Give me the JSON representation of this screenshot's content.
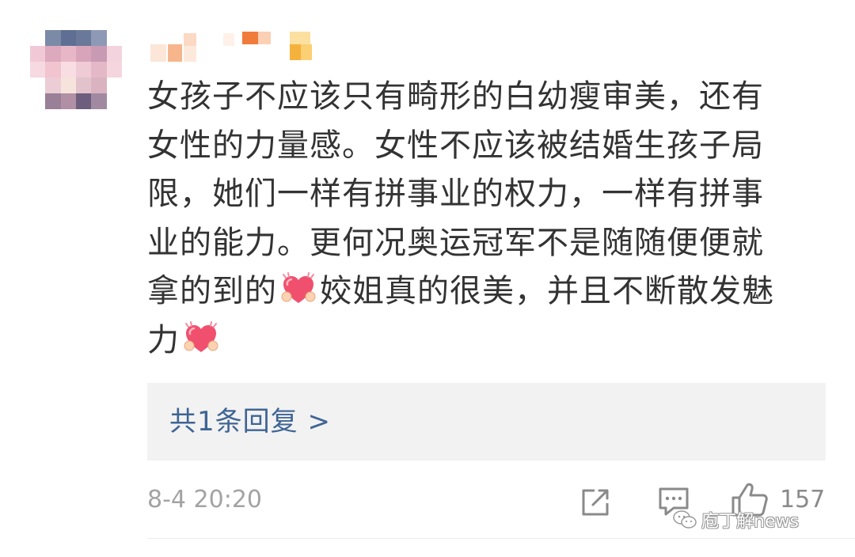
{
  "user": {
    "avatar_icon": "blurred-avatar",
    "name_obscured": true
  },
  "comment": {
    "line1": "女孩子不应该只有畸形的白幼瘦审美，还有",
    "line2": "女性的力量感。女性不应该被结婚生孩子局",
    "line3": "限，她们一样有拼事业的权力，一样有拼事",
    "line4": "业的能力。更何况奥运冠军不是随随便便就",
    "line5a": "拿的到的",
    "line5b": "姣姐真的很美，并且不断散发魅",
    "line6": "力",
    "emoji": "hugging-heart-emoji"
  },
  "replies": {
    "label": "共1条回复 >"
  },
  "footer": {
    "timestamp": "8-4 20:20",
    "share_icon": "share-icon",
    "comment_icon": "comment-icon",
    "like_icon": "thumbs-up-icon",
    "like_count": "157"
  },
  "watermark": {
    "text": "庖丁解news"
  },
  "colors": {
    "text": "#333333",
    "link": "#3f6594",
    "muted": "#a3a3a3",
    "reply_bg": "#f2f2f2",
    "heart": "#f0506e"
  }
}
